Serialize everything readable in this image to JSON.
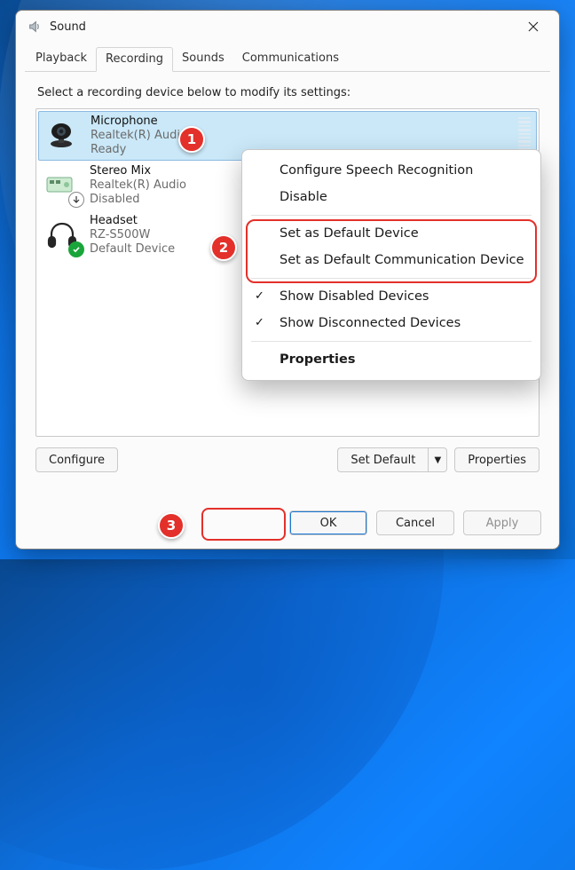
{
  "dialog": {
    "title": "Sound",
    "close_label": "Close"
  },
  "tabs": [
    {
      "label": "Playback"
    },
    {
      "label": "Recording",
      "active": true
    },
    {
      "label": "Sounds"
    },
    {
      "label": "Communications"
    }
  ],
  "prompt": "Select a recording device below to modify its settings:",
  "devices": [
    {
      "name": "Microphone",
      "sub": "Realtek(R) Audio",
      "status": "Ready",
      "icon": "webcam",
      "selected": true
    },
    {
      "name": "Stereo Mix",
      "sub": "Realtek(R) Audio",
      "status": "Disabled",
      "icon": "board",
      "badge": "down"
    },
    {
      "name": "Headset",
      "sub": "RZ-S500W",
      "status": "Default Device",
      "icon": "headset",
      "badge": "ok"
    }
  ],
  "buttons": {
    "configure": "Configure",
    "set_default": "Set Default",
    "properties": "Properties",
    "ok": "OK",
    "cancel": "Cancel",
    "apply": "Apply"
  },
  "context_menu": {
    "items": [
      {
        "label": "Configure Speech Recognition"
      },
      {
        "label": "Disable"
      },
      {
        "sep": true
      },
      {
        "label": "Set as Default Device"
      },
      {
        "label": "Set as Default Communication Device"
      },
      {
        "sep": true
      },
      {
        "label": "Show Disabled Devices",
        "checked": true
      },
      {
        "label": "Show Disconnected Devices",
        "checked": true
      },
      {
        "sep": true
      },
      {
        "label": "Properties",
        "bold": true
      }
    ]
  },
  "annotations": {
    "b1": "1",
    "b2": "2",
    "b3": "3"
  }
}
